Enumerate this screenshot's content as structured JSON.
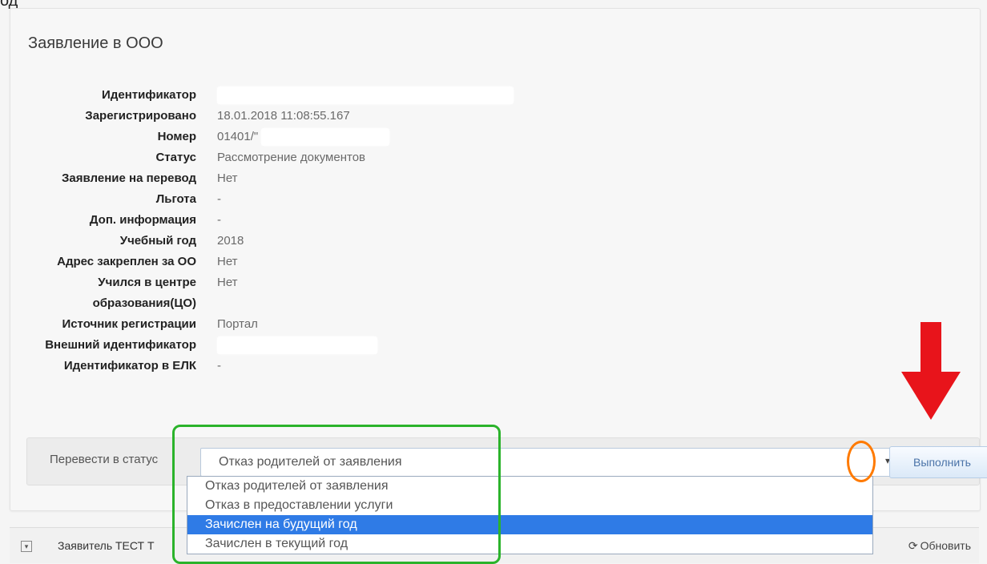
{
  "corner_text": "од",
  "card": {
    "title": "Заявление в ООО",
    "properties": [
      {
        "label": "Идентификатор",
        "value": "",
        "redacted": true
      },
      {
        "label": "Зарегистрировано",
        "value": "18.01.2018 11:08:55.167"
      },
      {
        "label": "Номер",
        "value": "01401/\"",
        "redacted_tail": true
      },
      {
        "label": "Статус",
        "value": "Рассмотрение документов"
      },
      {
        "label": "Заявление на перевод",
        "value": "Нет"
      },
      {
        "label": "Льгота",
        "value": "-"
      },
      {
        "label": "Доп. информация",
        "value": "-"
      },
      {
        "label": "Учебный год",
        "value": "2018"
      },
      {
        "label": "Адрес закреплен за ОО",
        "value": "Нет"
      },
      {
        "label": "Учился в центре образования(ЦО)",
        "value": "Нет"
      },
      {
        "label": "Источник регистрации",
        "value": "Портал"
      },
      {
        "label": "Внешний идентификатор",
        "value": "",
        "redacted": true
      },
      {
        "label": "Идентификатор в ЕЛК",
        "value": "-"
      }
    ]
  },
  "action_bar": {
    "status_label": "Перевести в статус",
    "selected_value": "Отказ родителей от заявления",
    "arrow": "▾",
    "execute_label": "Выполнить"
  },
  "dropdown": {
    "options": [
      "Отказ родителей от заявления",
      "Отказ в предоставлении услуги",
      "Зачислен на будущий год",
      "Зачислен в текущий год"
    ],
    "highlighted_index": 2
  },
  "bottom_panel": {
    "applicant_label": "Заявитель ТЕСТ Т",
    "refresh_label": "Обновить",
    "refresh_icon": "⟳"
  },
  "annotations": {
    "green_color": "#2bb32b",
    "orange_color": "#ff7a00",
    "red_color": "#e8141b"
  },
  "icons": {
    "expand": "expand-toggle-icon",
    "refresh": "refresh-icon",
    "arrow": "red-arrow-icon"
  }
}
